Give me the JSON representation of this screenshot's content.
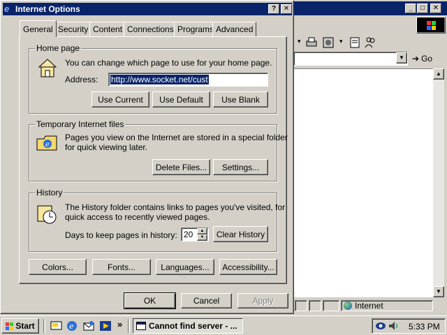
{
  "dialog": {
    "title": "Internet Options",
    "help_btn": "?",
    "close_btn": "✕",
    "tabs": [
      "General",
      "Security",
      "Content",
      "Connections",
      "Programs",
      "Advanced"
    ],
    "home": {
      "group": "Home page",
      "desc": "You can change which page to use for your home page.",
      "address_label": "Address:",
      "address_value": "http://www.socket.net/cust",
      "use_current": "Use Current",
      "use_default": "Use Default",
      "use_blank": "Use Blank"
    },
    "temp": {
      "group": "Temporary Internet files",
      "desc1": "Pages you view on the Internet are stored in a special folder",
      "desc2": "for quick viewing later.",
      "delete": "Delete Files...",
      "settings": "Settings..."
    },
    "history": {
      "group": "History",
      "desc1": "The History folder contains links to pages you've visited, for",
      "desc2": "quick access to recently viewed pages.",
      "days_label": "Days to keep pages in history:",
      "days_value": "20",
      "clear": "Clear History"
    },
    "bottom": {
      "colors": "Colors...",
      "fonts": "Fonts...",
      "languages": "Languages...",
      "accessibility": "Accessibility..."
    },
    "ok": "OK",
    "cancel": "Cancel",
    "apply": "Apply"
  },
  "browser": {
    "go": "Go",
    "status_zone": "Internet"
  },
  "taskbar": {
    "start": "Start",
    "task": "Cannot find server - ...",
    "clock": "5:33 PM",
    "chevron": "»"
  },
  "colors": {
    "titlebar": "#0a246a",
    "face": "#d4d0c8",
    "selection": "#0a246a"
  }
}
